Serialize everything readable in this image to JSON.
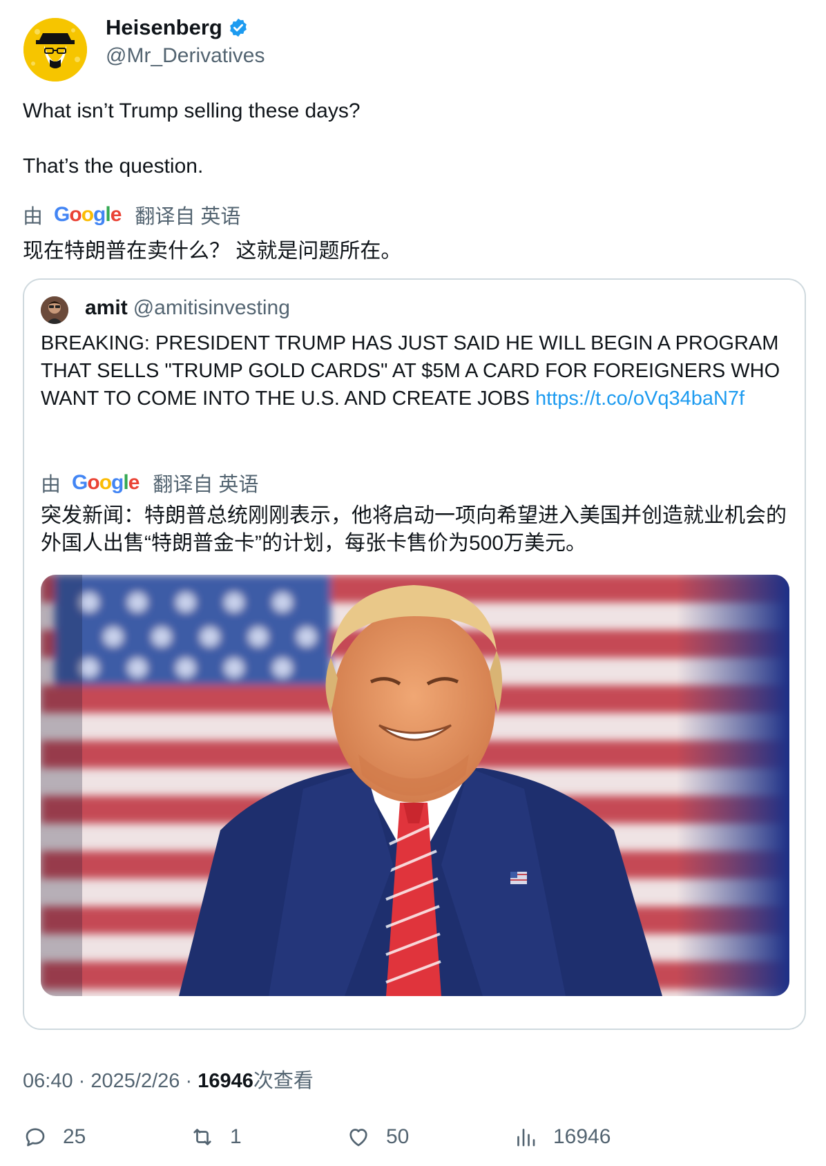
{
  "author": {
    "name": "Heisenberg",
    "handle": "@Mr_Derivatives",
    "verified": true
  },
  "tweet": {
    "line1": "What isn’t Trump selling these days?",
    "line2": "That’s the question.",
    "translation": {
      "by": "由",
      "brand": "Google",
      "from": "翻译自 英语",
      "text": "现在特朗普在卖什么？ 这就是问题所在。"
    }
  },
  "quote": {
    "name": "amit",
    "handle": "@amitisinvesting",
    "body": "BREAKING: PRESIDENT TRUMP HAS JUST SAID HE WILL BEGIN A PROGRAM THAT SELLS \"TRUMP GOLD CARDS\" AT $5M A CARD FOR FOREIGNERS WHO WANT TO COME INTO THE U.S. AND CREATE JOBS",
    "link": "https://t.co/oVq34baN7f",
    "translation": {
      "by": "由",
      "brand": "Google",
      "from": "翻译自 英语",
      "text": "突发新闻：特朗普总统刚刚表示，他将启动一项向希望进入美国并创造就业机会的外国人出售“特朗普金卡”的计划，每张卡售价为500万美元。"
    }
  },
  "meta": {
    "time": "06:40",
    "sep1": "·",
    "date": "2025/2/26",
    "sep2": "·",
    "views": "16946",
    "views_label": "次查看"
  },
  "actions": {
    "replies": "25",
    "reposts": "1",
    "likes": "50",
    "views": "16946"
  },
  "colors": {
    "link": "#1d9bf0",
    "muted": "#536471",
    "verified": "#1d9bf0",
    "border": "#cfd9de"
  }
}
